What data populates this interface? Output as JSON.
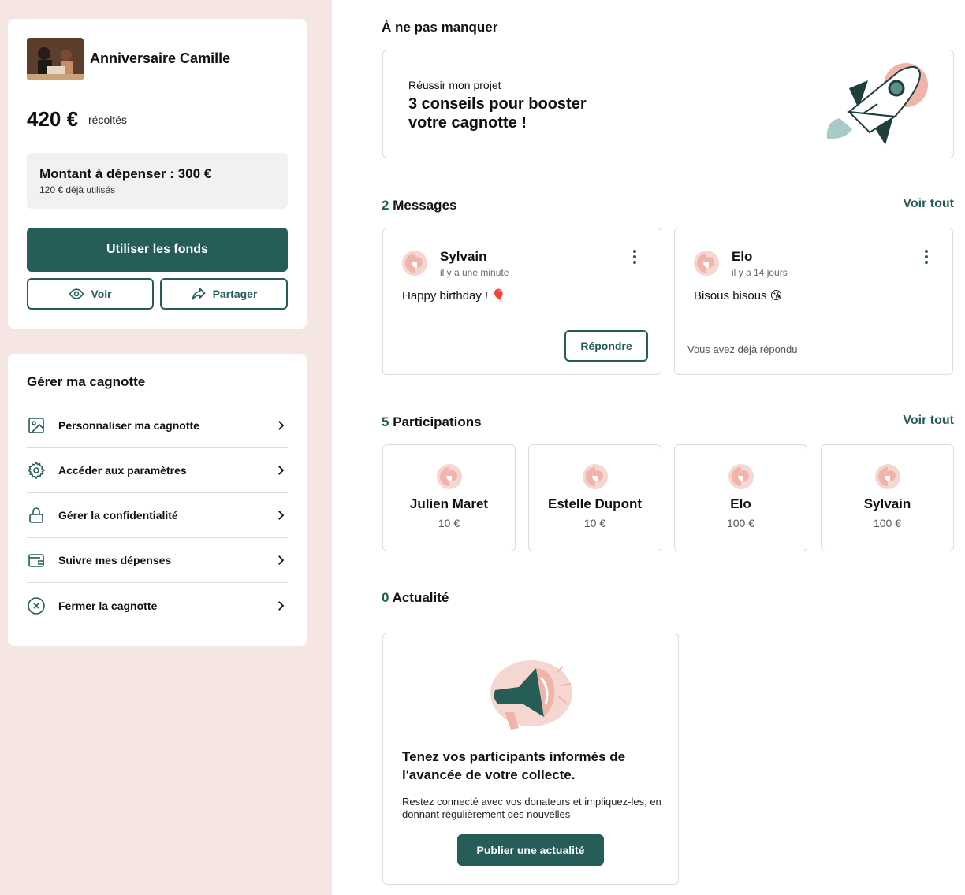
{
  "fund": {
    "title": "Anniversaire Camille",
    "amount": "420 €",
    "amount_label": "récoltés",
    "spend_title": "Montant à dépenser : 300 €",
    "spend_sub": "120 € déjà utilisés",
    "use_funds_label": "Utiliser les fonds",
    "view_label": "Voir",
    "share_label": "Partager"
  },
  "manage": {
    "title": "Gérer ma cagnotte",
    "items": [
      {
        "label": "Personnaliser ma cagnotte",
        "icon": "image-icon"
      },
      {
        "label": "Accéder aux paramètres",
        "icon": "gear-icon"
      },
      {
        "label": "Gérer la confidentialité",
        "icon": "lock-icon"
      },
      {
        "label": "Suivre mes dépenses",
        "icon": "wallet-icon"
      },
      {
        "label": "Fermer la cagnotte",
        "icon": "close-circle-icon"
      }
    ]
  },
  "tip": {
    "section_title": "À ne pas manquer",
    "kicker": "Réussir mon projet",
    "headline": "3 conseils pour booster votre cagnotte !"
  },
  "messages": {
    "count": "2",
    "title": "Messages",
    "see_all": "Voir tout",
    "items": [
      {
        "name": "Sylvain",
        "time": "il y a une minute",
        "text": "Happy birthday ! 🎈",
        "reply_label": "Répondre"
      },
      {
        "name": "Elo",
        "time": "il y a 14 jours",
        "text": "Bisous bisous 😘",
        "replied_label": "Vous avez déjà répondu"
      }
    ]
  },
  "participations": {
    "count": "5",
    "title": "Participations",
    "see_all": "Voir tout",
    "items": [
      {
        "name": "Julien Maret",
        "amount": "10 €"
      },
      {
        "name": "Estelle Dupont",
        "amount": "10 €"
      },
      {
        "name": "Elo",
        "amount": "100 €"
      },
      {
        "name": "Sylvain",
        "amount": "100 €"
      }
    ]
  },
  "news": {
    "count": "0",
    "title": "Actualité",
    "card_title": "Tenez vos participants informés de l'avancée de votre collecte.",
    "card_sub": "Restez connecté avec vos donateurs et impliquez-les, en donnant régulièrement des nouvelles",
    "publish_label": "Publier une actualité"
  },
  "colors": {
    "brand": "#265d58",
    "sidebar_bg": "#f5e6e3",
    "accent_pink": "#f0b4ab"
  }
}
